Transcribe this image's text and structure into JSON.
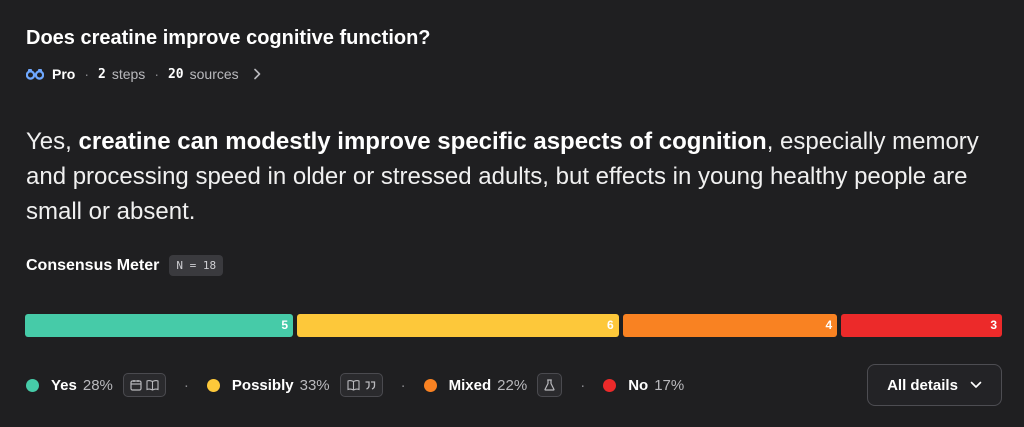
{
  "header": {
    "question": "Does creatine improve cognitive function?",
    "mode": "Pro",
    "steps_count": "2",
    "steps_label": "steps",
    "sources_count": "20",
    "sources_label": "sources",
    "separator": "·"
  },
  "answer": {
    "prefix": "Yes, ",
    "bold": "creatine can modestly improve specific aspects of cognition",
    "rest": ", especially memory and processing speed in older or stressed adults, but effects in young healthy people are small or absent."
  },
  "consensus": {
    "title": "Consensus Meter",
    "n_badge": "N = 18",
    "segments": [
      {
        "label": "Yes",
        "count": "5",
        "percent": "28%",
        "color": "#46cba8"
      },
      {
        "label": "Possibly",
        "count": "6",
        "percent": "33%",
        "color": "#fdc83a"
      },
      {
        "label": "Mixed",
        "count": "4",
        "percent": "22%",
        "color": "#f98222"
      },
      {
        "label": "No",
        "count": "3",
        "percent": "17%",
        "color": "#ec2a2a"
      }
    ]
  },
  "details_button": {
    "label": "All details"
  },
  "icons": {
    "pro": "binoculars-icon",
    "chevron": "chevron-right-icon",
    "yes_badge": "calendar-book-icon",
    "possibly_badge": "book-quote-icon",
    "mixed_badge": "flask-icon",
    "details": "chevron-down-icon"
  }
}
